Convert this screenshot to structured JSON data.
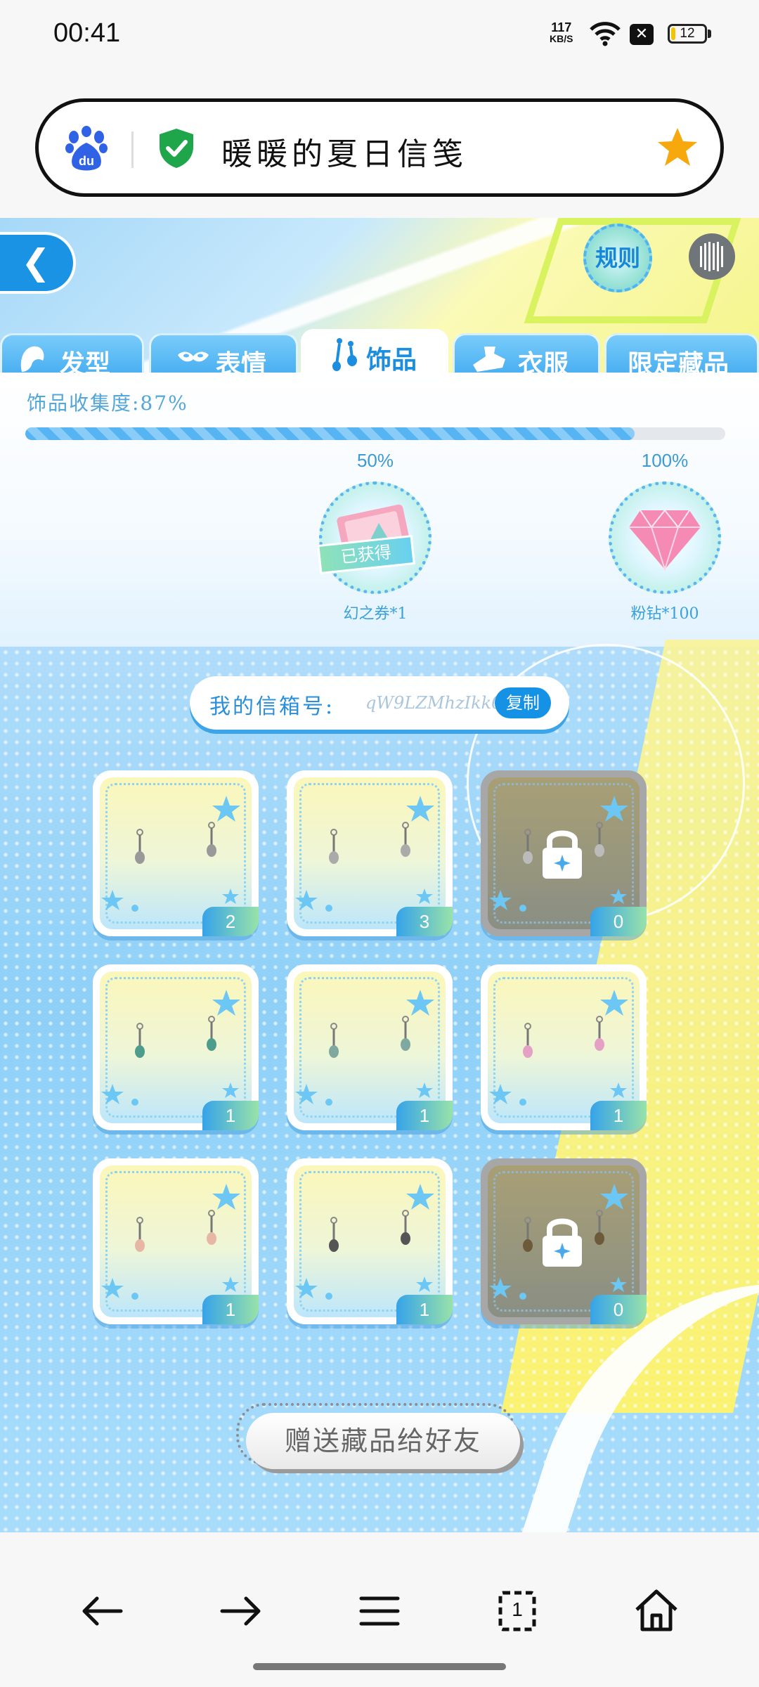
{
  "status_bar": {
    "time": "00:41",
    "net_speed_value": "117",
    "net_speed_unit": "KB/S",
    "battery": "12",
    "battery_level_percent": 12
  },
  "browser": {
    "page_title": "暖暖的夏日信笺",
    "favorite_starred": true
  },
  "game": {
    "rules_label": "规则",
    "tabs": [
      {
        "label": "发型",
        "icon": "hair-icon",
        "active": false
      },
      {
        "label": "表情",
        "icon": "mask-icon",
        "active": false
      },
      {
        "label": "饰品",
        "icon": "earring-icon",
        "active": true
      },
      {
        "label": "衣服",
        "icon": "clothes-icon",
        "active": false
      },
      {
        "label": "限定藏品",
        "icon": "",
        "active": false
      }
    ],
    "collection": {
      "label": "饰品收集度:87%",
      "progress_percent": 87,
      "milestones": [
        {
          "percent": "50%",
          "reward": "幻之券*1",
          "obtained_label": "已获得",
          "obtained": true
        },
        {
          "percent": "100%",
          "reward": "粉钻*100",
          "obtained": false
        }
      ]
    },
    "mailbox": {
      "label": "我的信箱号:",
      "code": "qW9LZMhzIkk0",
      "copy_label": "复制"
    },
    "items": [
      {
        "count": "2",
        "locked": false,
        "icon": "earring-icon"
      },
      {
        "count": "3",
        "locked": false,
        "icon": "earring-icon"
      },
      {
        "count": "0",
        "locked": true,
        "icon": "earring-icon"
      },
      {
        "count": "1",
        "locked": false,
        "icon": "earring-icon"
      },
      {
        "count": "1",
        "locked": false,
        "icon": "earring-icon"
      },
      {
        "count": "1",
        "locked": false,
        "icon": "earring-icon"
      },
      {
        "count": "1",
        "locked": false,
        "icon": "earring-icon"
      },
      {
        "count": "1",
        "locked": false,
        "icon": "earring-icon"
      },
      {
        "count": "0",
        "locked": true,
        "icon": "earring-icon"
      }
    ],
    "send_button": "赠送藏品给好友"
  },
  "bottom_nav": {
    "items": [
      "back-arrow-icon",
      "forward-arrow-icon",
      "menu-icon",
      "tabs-icon",
      "home-icon"
    ],
    "tab_count": "1"
  }
}
